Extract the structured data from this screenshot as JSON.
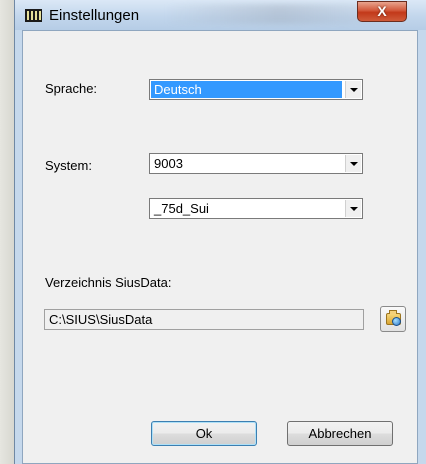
{
  "window": {
    "title": "Einstellungen",
    "close_label": "X"
  },
  "language": {
    "label": "Sprache:",
    "selected": "Deutsch"
  },
  "system": {
    "label": "System:",
    "selected": "9003",
    "variant": "_75d_Sui"
  },
  "data_dir": {
    "label": "Verzeichnis SiusData:",
    "path": "C:\\SIUS\\SiusData",
    "browse_icon": "folder-browse-icon"
  },
  "buttons": {
    "ok": "Ok",
    "cancel": "Abbrechen"
  },
  "colors": {
    "selection": "#3399ff",
    "close": "#c2391a"
  }
}
